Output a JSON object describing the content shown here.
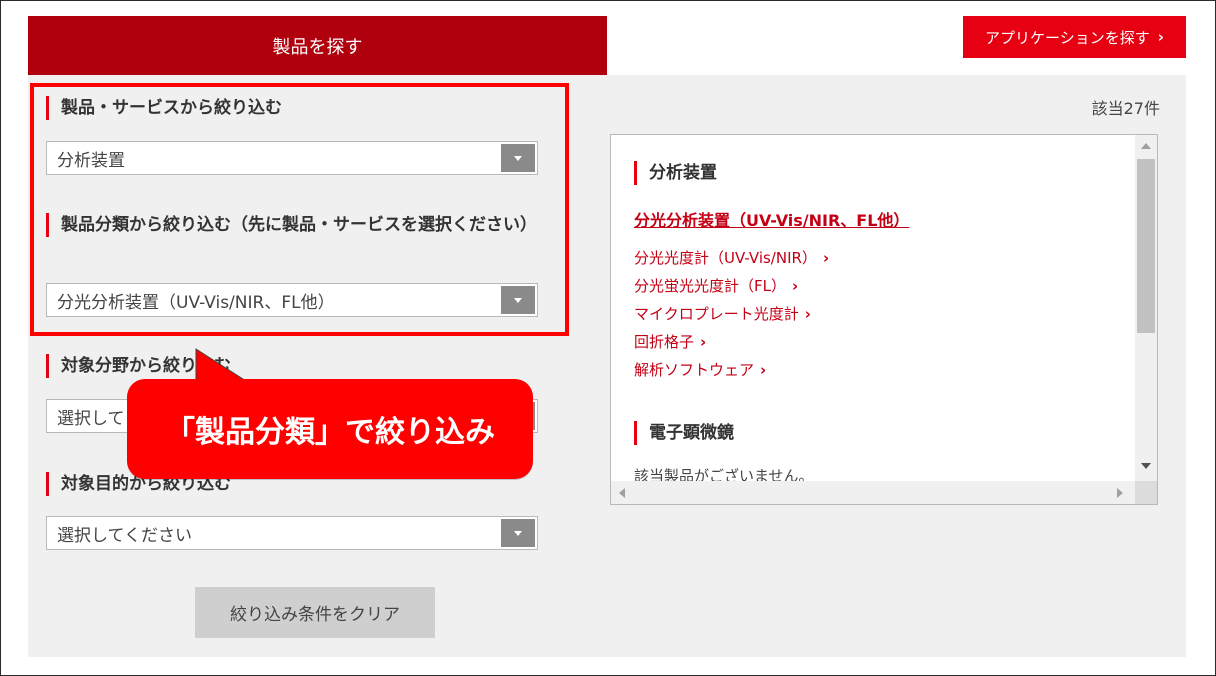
{
  "tabs": {
    "products_label": "製品を探す",
    "applications_label": "アプリケーションを探す",
    "applications_chevron": "›"
  },
  "result_count": "該当27件",
  "filters": [
    {
      "label": "製品・サービスから絞り込む",
      "value": "分析装置"
    },
    {
      "label": "製品分類から絞り込む（先に製品・サービスを選択ください）",
      "value": "分光分析装置（UV-Vis/NIR、FL他）"
    },
    {
      "label": "対象分野から絞り込む",
      "value": "選択してください"
    },
    {
      "label": "対象目的から絞り込む",
      "value": "選択してください"
    }
  ],
  "clear_label": "絞り込み条件をクリア",
  "callout_text": "「製品分類」で絞り込み",
  "results": {
    "category_1": "分析装置",
    "subcategory": "分光分析装置（UV-Vis/NIR、FL他）",
    "items": [
      "分光光度計（UV-Vis/NIR）",
      "分光蛍光光度計（FL）",
      "マイクロプレート光度計",
      "回折格子",
      "解析ソフトウェア"
    ],
    "chevron": "›",
    "category_2": "電子顕微鏡",
    "no_product": "該当製品がございません。"
  },
  "colors": {
    "brand_dark_red": "#b0000d",
    "brand_red": "#e60012",
    "highlight_red": "#ff0000",
    "panel_gray": "#f0f0f0"
  }
}
